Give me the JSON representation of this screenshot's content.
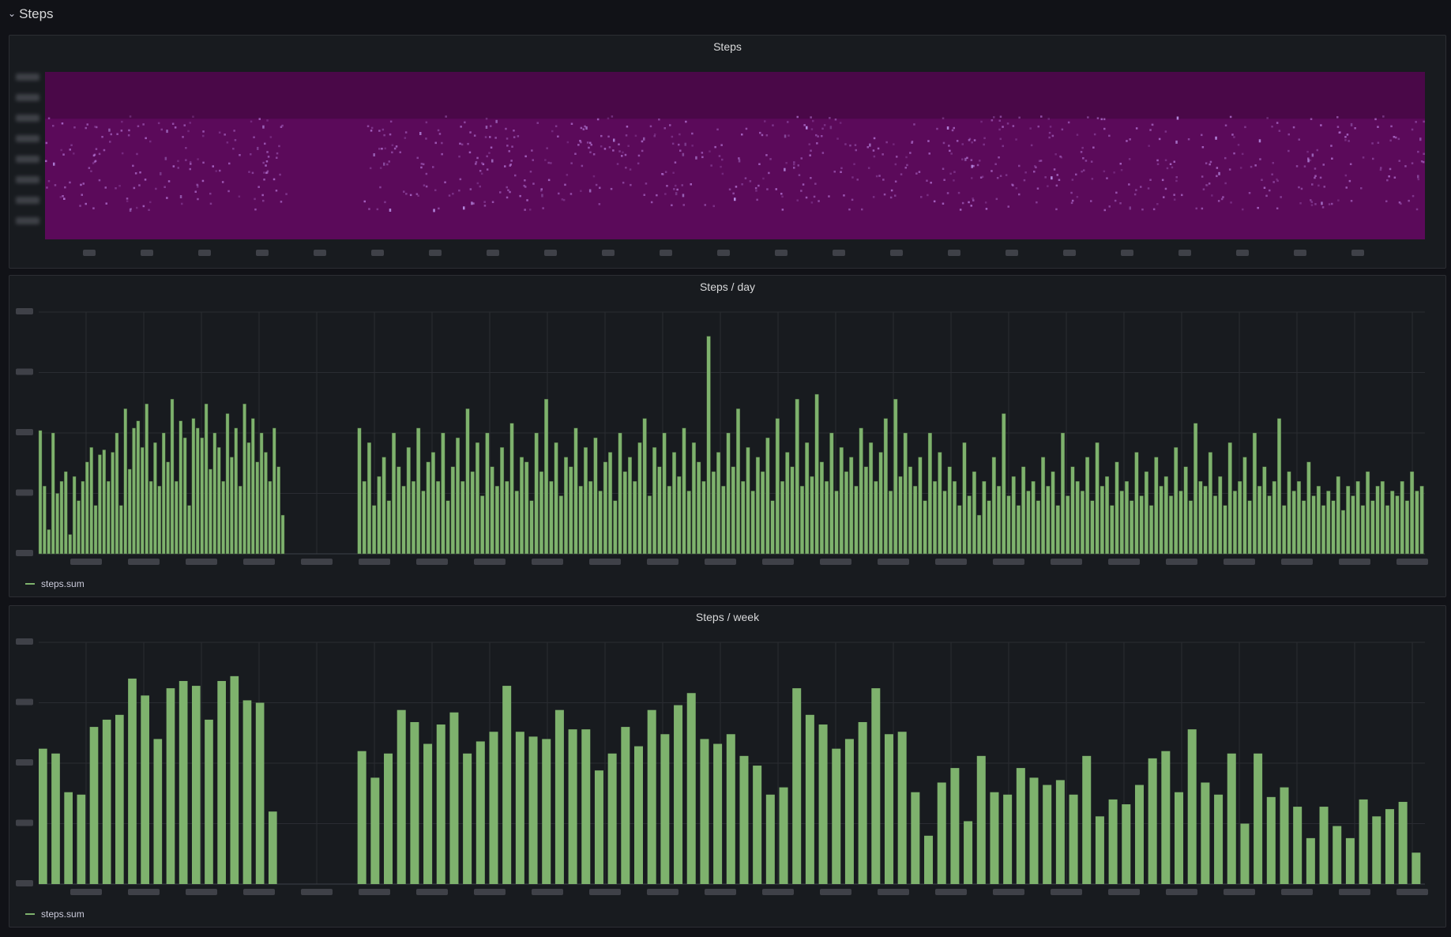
{
  "row": {
    "title": "Steps",
    "collapse_icon": "chevron-down-icon"
  },
  "colors": {
    "background": "#111217",
    "panel": "#181b1f",
    "bar": "#7eb26d",
    "heatmap_low": "#5b0a5a",
    "heatmap_high": "#c9a6ff"
  },
  "panels": {
    "heatmap": {
      "title": "Steps"
    },
    "daily": {
      "title": "Steps / day",
      "legend": "steps.sum"
    },
    "weekly": {
      "title": "Steps / week",
      "legend": "steps.sum"
    }
  },
  "chart_data": [
    {
      "type": "heatmap",
      "title": "Steps",
      "gap": [
        0.175,
        0.23
      ],
      "tick_labels_legible": false
    },
    {
      "type": "bar",
      "title": "Steps / day",
      "series": [
        {
          "name": "steps.sum"
        }
      ],
      "ylim": [
        0,
        1
      ],
      "gap": [
        0.178,
        0.23
      ],
      "values_normalized": [
        0.51,
        0.28,
        0.1,
        0.5,
        0.25,
        0.3,
        0.34,
        0.08,
        0.32,
        0.22,
        0.3,
        0.38,
        0.44,
        0.2,
        0.41,
        0.43,
        0.3,
        0.42,
        0.5,
        0.2,
        0.6,
        0.35,
        0.52,
        0.55,
        0.44,
        0.62,
        0.3,
        0.46,
        0.28,
        0.5,
        0.38,
        0.64,
        0.3,
        0.55,
        0.48,
        0.2,
        0.56,
        0.52,
        0.48,
        0.62,
        0.35,
        0.5,
        0.44,
        0.3,
        0.58,
        0.4,
        0.52,
        0.28,
        0.62,
        0.46,
        0.56,
        0.38,
        0.5,
        0.42,
        0.3,
        0.52,
        0.36,
        0.16,
        0.52,
        0.3,
        0.46,
        0.2,
        0.32,
        0.4,
        0.22,
        0.5,
        0.36,
        0.28,
        0.44,
        0.3,
        0.52,
        0.26,
        0.38,
        0.42,
        0.3,
        0.5,
        0.22,
        0.36,
        0.48,
        0.3,
        0.6,
        0.34,
        0.46,
        0.24,
        0.5,
        0.36,
        0.28,
        0.44,
        0.3,
        0.54,
        0.26,
        0.4,
        0.38,
        0.22,
        0.5,
        0.34,
        0.64,
        0.3,
        0.46,
        0.24,
        0.4,
        0.36,
        0.52,
        0.28,
        0.44,
        0.3,
        0.48,
        0.26,
        0.38,
        0.42,
        0.22,
        0.5,
        0.34,
        0.4,
        0.3,
        0.46,
        0.56,
        0.24,
        0.44,
        0.36,
        0.5,
        0.28,
        0.42,
        0.32,
        0.52,
        0.26,
        0.46,
        0.38,
        0.3,
        0.9,
        0.34,
        0.42,
        0.28,
        0.5,
        0.36,
        0.6,
        0.3,
        0.44,
        0.26,
        0.4,
        0.34,
        0.48,
        0.22,
        0.56,
        0.3,
        0.42,
        0.36,
        0.64,
        0.28,
        0.46,
        0.32,
        0.66,
        0.38,
        0.3,
        0.5,
        0.26,
        0.44,
        0.34,
        0.4,
        0.28,
        0.52,
        0.36,
        0.46,
        0.3,
        0.42,
        0.56,
        0.26,
        0.64,
        0.32,
        0.5,
        0.36,
        0.28,
        0.4,
        0.22,
        0.5,
        0.3,
        0.42,
        0.26,
        0.36,
        0.3,
        0.2,
        0.46,
        0.24,
        0.34,
        0.16,
        0.3,
        0.22,
        0.4,
        0.28,
        0.58,
        0.24,
        0.32,
        0.2,
        0.36,
        0.26,
        0.3,
        0.22,
        0.4,
        0.28,
        0.34,
        0.2,
        0.5,
        0.24,
        0.36,
        0.3,
        0.26,
        0.4,
        0.22,
        0.46,
        0.28,
        0.32,
        0.2,
        0.38,
        0.26,
        0.3,
        0.22,
        0.42,
        0.24,
        0.34,
        0.2,
        0.4,
        0.28,
        0.32,
        0.24,
        0.44,
        0.26,
        0.36,
        0.22,
        0.54,
        0.3,
        0.28,
        0.42,
        0.24,
        0.32,
        0.2,
        0.46,
        0.26,
        0.3,
        0.4,
        0.22,
        0.5,
        0.28,
        0.36,
        0.24,
        0.3,
        0.56,
        0.2,
        0.34,
        0.26,
        0.3,
        0.22,
        0.38,
        0.24,
        0.28,
        0.2,
        0.26,
        0.22,
        0.32,
        0.18,
        0.28,
        0.24,
        0.3,
        0.2,
        0.34,
        0.22,
        0.28,
        0.3,
        0.2,
        0.26,
        0.24,
        0.3,
        0.22,
        0.34,
        0.26,
        0.28
      ]
    },
    {
      "type": "bar",
      "title": "Steps / week",
      "series": [
        {
          "name": "steps.sum"
        }
      ],
      "ylim": [
        0,
        1
      ],
      "gap": [
        0.175,
        0.23
      ],
      "values_normalized": [
        0.56,
        0.54,
        0.38,
        0.37,
        0.65,
        0.68,
        0.7,
        0.85,
        0.78,
        0.6,
        0.81,
        0.84,
        0.82,
        0.68,
        0.84,
        0.86,
        0.76,
        0.75,
        0.3,
        0.55,
        0.44,
        0.54,
        0.72,
        0.67,
        0.58,
        0.66,
        0.71,
        0.54,
        0.59,
        0.63,
        0.82,
        0.63,
        0.61,
        0.6,
        0.72,
        0.64,
        0.64,
        0.47,
        0.54,
        0.65,
        0.57,
        0.72,
        0.62,
        0.74,
        0.79,
        0.6,
        0.58,
        0.62,
        0.53,
        0.49,
        0.37,
        0.4,
        0.81,
        0.7,
        0.66,
        0.56,
        0.6,
        0.67,
        0.81,
        0.62,
        0.63,
        0.38,
        0.2,
        0.42,
        0.48,
        0.26,
        0.53,
        0.38,
        0.37,
        0.48,
        0.44,
        0.41,
        0.43,
        0.37,
        0.53,
        0.28,
        0.35,
        0.33,
        0.41,
        0.52,
        0.55,
        0.38,
        0.64,
        0.42,
        0.37,
        0.54,
        0.25,
        0.54,
        0.36,
        0.4,
        0.32,
        0.19,
        0.32,
        0.24,
        0.19,
        0.35,
        0.28,
        0.31,
        0.34,
        0.13
      ]
    }
  ]
}
